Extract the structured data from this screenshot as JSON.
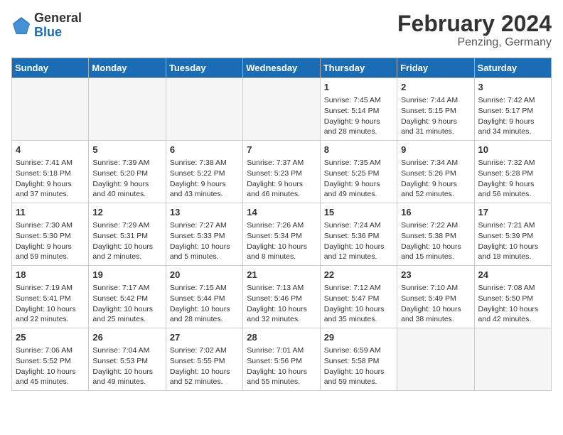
{
  "header": {
    "logo_general": "General",
    "logo_blue": "Blue",
    "title": "February 2024",
    "subtitle": "Penzing, Germany"
  },
  "days_of_week": [
    "Sunday",
    "Monday",
    "Tuesday",
    "Wednesday",
    "Thursday",
    "Friday",
    "Saturday"
  ],
  "weeks": [
    [
      {
        "day": "",
        "info": ""
      },
      {
        "day": "",
        "info": ""
      },
      {
        "day": "",
        "info": ""
      },
      {
        "day": "",
        "info": ""
      },
      {
        "day": "1",
        "info": "Sunrise: 7:45 AM\nSunset: 5:14 PM\nDaylight: 9 hours and 28 minutes."
      },
      {
        "day": "2",
        "info": "Sunrise: 7:44 AM\nSunset: 5:15 PM\nDaylight: 9 hours and 31 minutes."
      },
      {
        "day": "3",
        "info": "Sunrise: 7:42 AM\nSunset: 5:17 PM\nDaylight: 9 hours and 34 minutes."
      }
    ],
    [
      {
        "day": "4",
        "info": "Sunrise: 7:41 AM\nSunset: 5:18 PM\nDaylight: 9 hours and 37 minutes."
      },
      {
        "day": "5",
        "info": "Sunrise: 7:39 AM\nSunset: 5:20 PM\nDaylight: 9 hours and 40 minutes."
      },
      {
        "day": "6",
        "info": "Sunrise: 7:38 AM\nSunset: 5:22 PM\nDaylight: 9 hours and 43 minutes."
      },
      {
        "day": "7",
        "info": "Sunrise: 7:37 AM\nSunset: 5:23 PM\nDaylight: 9 hours and 46 minutes."
      },
      {
        "day": "8",
        "info": "Sunrise: 7:35 AM\nSunset: 5:25 PM\nDaylight: 9 hours and 49 minutes."
      },
      {
        "day": "9",
        "info": "Sunrise: 7:34 AM\nSunset: 5:26 PM\nDaylight: 9 hours and 52 minutes."
      },
      {
        "day": "10",
        "info": "Sunrise: 7:32 AM\nSunset: 5:28 PM\nDaylight: 9 hours and 56 minutes."
      }
    ],
    [
      {
        "day": "11",
        "info": "Sunrise: 7:30 AM\nSunset: 5:30 PM\nDaylight: 9 hours and 59 minutes."
      },
      {
        "day": "12",
        "info": "Sunrise: 7:29 AM\nSunset: 5:31 PM\nDaylight: 10 hours and 2 minutes."
      },
      {
        "day": "13",
        "info": "Sunrise: 7:27 AM\nSunset: 5:33 PM\nDaylight: 10 hours and 5 minutes."
      },
      {
        "day": "14",
        "info": "Sunrise: 7:26 AM\nSunset: 5:34 PM\nDaylight: 10 hours and 8 minutes."
      },
      {
        "day": "15",
        "info": "Sunrise: 7:24 AM\nSunset: 5:36 PM\nDaylight: 10 hours and 12 minutes."
      },
      {
        "day": "16",
        "info": "Sunrise: 7:22 AM\nSunset: 5:38 PM\nDaylight: 10 hours and 15 minutes."
      },
      {
        "day": "17",
        "info": "Sunrise: 7:21 AM\nSunset: 5:39 PM\nDaylight: 10 hours and 18 minutes."
      }
    ],
    [
      {
        "day": "18",
        "info": "Sunrise: 7:19 AM\nSunset: 5:41 PM\nDaylight: 10 hours and 22 minutes."
      },
      {
        "day": "19",
        "info": "Sunrise: 7:17 AM\nSunset: 5:42 PM\nDaylight: 10 hours and 25 minutes."
      },
      {
        "day": "20",
        "info": "Sunrise: 7:15 AM\nSunset: 5:44 PM\nDaylight: 10 hours and 28 minutes."
      },
      {
        "day": "21",
        "info": "Sunrise: 7:13 AM\nSunset: 5:46 PM\nDaylight: 10 hours and 32 minutes."
      },
      {
        "day": "22",
        "info": "Sunrise: 7:12 AM\nSunset: 5:47 PM\nDaylight: 10 hours and 35 minutes."
      },
      {
        "day": "23",
        "info": "Sunrise: 7:10 AM\nSunset: 5:49 PM\nDaylight: 10 hours and 38 minutes."
      },
      {
        "day": "24",
        "info": "Sunrise: 7:08 AM\nSunset: 5:50 PM\nDaylight: 10 hours and 42 minutes."
      }
    ],
    [
      {
        "day": "25",
        "info": "Sunrise: 7:06 AM\nSunset: 5:52 PM\nDaylight: 10 hours and 45 minutes."
      },
      {
        "day": "26",
        "info": "Sunrise: 7:04 AM\nSunset: 5:53 PM\nDaylight: 10 hours and 49 minutes."
      },
      {
        "day": "27",
        "info": "Sunrise: 7:02 AM\nSunset: 5:55 PM\nDaylight: 10 hours and 52 minutes."
      },
      {
        "day": "28",
        "info": "Sunrise: 7:01 AM\nSunset: 5:56 PM\nDaylight: 10 hours and 55 minutes."
      },
      {
        "day": "29",
        "info": "Sunrise: 6:59 AM\nSunset: 5:58 PM\nDaylight: 10 hours and 59 minutes."
      },
      {
        "day": "",
        "info": ""
      },
      {
        "day": "",
        "info": ""
      }
    ]
  ]
}
